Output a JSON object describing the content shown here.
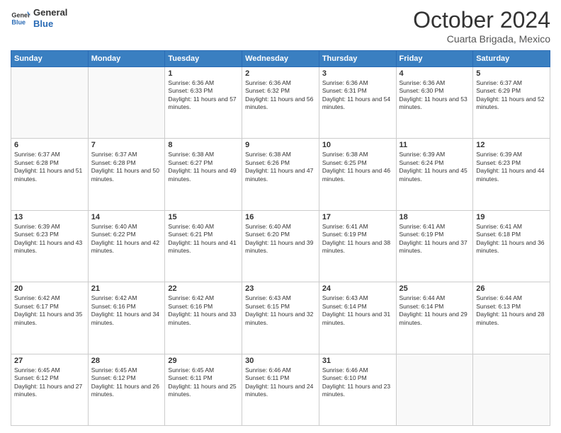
{
  "header": {
    "logo_general": "General",
    "logo_blue": "Blue",
    "month": "October 2024",
    "location": "Cuarta Brigada, Mexico"
  },
  "weekdays": [
    "Sunday",
    "Monday",
    "Tuesday",
    "Wednesday",
    "Thursday",
    "Friday",
    "Saturday"
  ],
  "weeks": [
    [
      {
        "day": "",
        "info": ""
      },
      {
        "day": "",
        "info": ""
      },
      {
        "day": "1",
        "info": "Sunrise: 6:36 AM\nSunset: 6:33 PM\nDaylight: 11 hours and 57 minutes."
      },
      {
        "day": "2",
        "info": "Sunrise: 6:36 AM\nSunset: 6:32 PM\nDaylight: 11 hours and 56 minutes."
      },
      {
        "day": "3",
        "info": "Sunrise: 6:36 AM\nSunset: 6:31 PM\nDaylight: 11 hours and 54 minutes."
      },
      {
        "day": "4",
        "info": "Sunrise: 6:36 AM\nSunset: 6:30 PM\nDaylight: 11 hours and 53 minutes."
      },
      {
        "day": "5",
        "info": "Sunrise: 6:37 AM\nSunset: 6:29 PM\nDaylight: 11 hours and 52 minutes."
      }
    ],
    [
      {
        "day": "6",
        "info": "Sunrise: 6:37 AM\nSunset: 6:28 PM\nDaylight: 11 hours and 51 minutes."
      },
      {
        "day": "7",
        "info": "Sunrise: 6:37 AM\nSunset: 6:28 PM\nDaylight: 11 hours and 50 minutes."
      },
      {
        "day": "8",
        "info": "Sunrise: 6:38 AM\nSunset: 6:27 PM\nDaylight: 11 hours and 49 minutes."
      },
      {
        "day": "9",
        "info": "Sunrise: 6:38 AM\nSunset: 6:26 PM\nDaylight: 11 hours and 47 minutes."
      },
      {
        "day": "10",
        "info": "Sunrise: 6:38 AM\nSunset: 6:25 PM\nDaylight: 11 hours and 46 minutes."
      },
      {
        "day": "11",
        "info": "Sunrise: 6:39 AM\nSunset: 6:24 PM\nDaylight: 11 hours and 45 minutes."
      },
      {
        "day": "12",
        "info": "Sunrise: 6:39 AM\nSunset: 6:23 PM\nDaylight: 11 hours and 44 minutes."
      }
    ],
    [
      {
        "day": "13",
        "info": "Sunrise: 6:39 AM\nSunset: 6:23 PM\nDaylight: 11 hours and 43 minutes."
      },
      {
        "day": "14",
        "info": "Sunrise: 6:40 AM\nSunset: 6:22 PM\nDaylight: 11 hours and 42 minutes."
      },
      {
        "day": "15",
        "info": "Sunrise: 6:40 AM\nSunset: 6:21 PM\nDaylight: 11 hours and 41 minutes."
      },
      {
        "day": "16",
        "info": "Sunrise: 6:40 AM\nSunset: 6:20 PM\nDaylight: 11 hours and 39 minutes."
      },
      {
        "day": "17",
        "info": "Sunrise: 6:41 AM\nSunset: 6:19 PM\nDaylight: 11 hours and 38 minutes."
      },
      {
        "day": "18",
        "info": "Sunrise: 6:41 AM\nSunset: 6:19 PM\nDaylight: 11 hours and 37 minutes."
      },
      {
        "day": "19",
        "info": "Sunrise: 6:41 AM\nSunset: 6:18 PM\nDaylight: 11 hours and 36 minutes."
      }
    ],
    [
      {
        "day": "20",
        "info": "Sunrise: 6:42 AM\nSunset: 6:17 PM\nDaylight: 11 hours and 35 minutes."
      },
      {
        "day": "21",
        "info": "Sunrise: 6:42 AM\nSunset: 6:16 PM\nDaylight: 11 hours and 34 minutes."
      },
      {
        "day": "22",
        "info": "Sunrise: 6:42 AM\nSunset: 6:16 PM\nDaylight: 11 hours and 33 minutes."
      },
      {
        "day": "23",
        "info": "Sunrise: 6:43 AM\nSunset: 6:15 PM\nDaylight: 11 hours and 32 minutes."
      },
      {
        "day": "24",
        "info": "Sunrise: 6:43 AM\nSunset: 6:14 PM\nDaylight: 11 hours and 31 minutes."
      },
      {
        "day": "25",
        "info": "Sunrise: 6:44 AM\nSunset: 6:14 PM\nDaylight: 11 hours and 29 minutes."
      },
      {
        "day": "26",
        "info": "Sunrise: 6:44 AM\nSunset: 6:13 PM\nDaylight: 11 hours and 28 minutes."
      }
    ],
    [
      {
        "day": "27",
        "info": "Sunrise: 6:45 AM\nSunset: 6:12 PM\nDaylight: 11 hours and 27 minutes."
      },
      {
        "day": "28",
        "info": "Sunrise: 6:45 AM\nSunset: 6:12 PM\nDaylight: 11 hours and 26 minutes."
      },
      {
        "day": "29",
        "info": "Sunrise: 6:45 AM\nSunset: 6:11 PM\nDaylight: 11 hours and 25 minutes."
      },
      {
        "day": "30",
        "info": "Sunrise: 6:46 AM\nSunset: 6:11 PM\nDaylight: 11 hours and 24 minutes."
      },
      {
        "day": "31",
        "info": "Sunrise: 6:46 AM\nSunset: 6:10 PM\nDaylight: 11 hours and 23 minutes."
      },
      {
        "day": "",
        "info": ""
      },
      {
        "day": "",
        "info": ""
      }
    ]
  ]
}
